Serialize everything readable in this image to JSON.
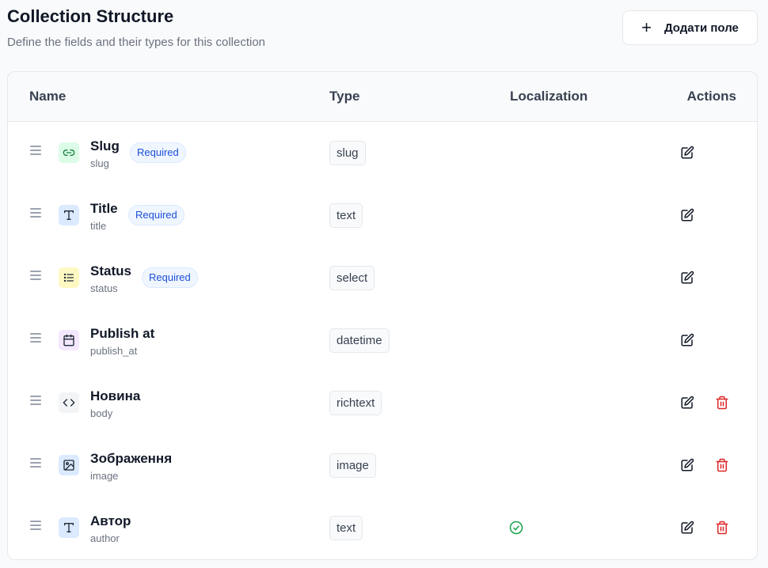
{
  "header": {
    "title": "Collection Structure",
    "subtitle": "Define the fields and their types for this collection",
    "add_button_label": "Додати поле"
  },
  "table": {
    "columns": [
      "Name",
      "Type",
      "Localization",
      "Actions"
    ],
    "required_label": "Required",
    "rows": [
      {
        "name": "Slug",
        "key": "slug",
        "type": "slug",
        "required": true,
        "localized": false,
        "deletable": false,
        "icon": "link-icon",
        "icon_bg": "#dcfce7",
        "icon_color": "#15803d"
      },
      {
        "name": "Title",
        "key": "title",
        "type": "text",
        "required": true,
        "localized": false,
        "deletable": false,
        "icon": "text-icon",
        "icon_bg": "#dbeafe",
        "icon_color": "#1f2937"
      },
      {
        "name": "Status",
        "key": "status",
        "type": "select",
        "required": true,
        "localized": false,
        "deletable": false,
        "icon": "list-icon",
        "icon_bg": "#fef9c3",
        "icon_color": "#1f2937"
      },
      {
        "name": "Publish at",
        "key": "publish_at",
        "type": "datetime",
        "required": false,
        "localized": false,
        "deletable": false,
        "icon": "calendar-icon",
        "icon_bg": "#f3e8ff",
        "icon_color": "#1f2937"
      },
      {
        "name": "Новина",
        "key": "body",
        "type": "richtext",
        "required": false,
        "localized": false,
        "deletable": true,
        "icon": "code-icon",
        "icon_bg": "#f3f4f6",
        "icon_color": "#1f2937"
      },
      {
        "name": "Зображення",
        "key": "image",
        "type": "image",
        "required": false,
        "localized": false,
        "deletable": true,
        "icon": "image-icon",
        "icon_bg": "#dbeafe",
        "icon_color": "#1f2937"
      },
      {
        "name": "Автор",
        "key": "author",
        "type": "text",
        "required": false,
        "localized": true,
        "deletable": true,
        "icon": "text-icon",
        "icon_bg": "#dbeafe",
        "icon_color": "#1f2937"
      }
    ]
  },
  "colors": {
    "required_text": "#1d4ed8",
    "localized_check": "#16a34a",
    "delete": "#dc2626",
    "edit": "#111827"
  }
}
